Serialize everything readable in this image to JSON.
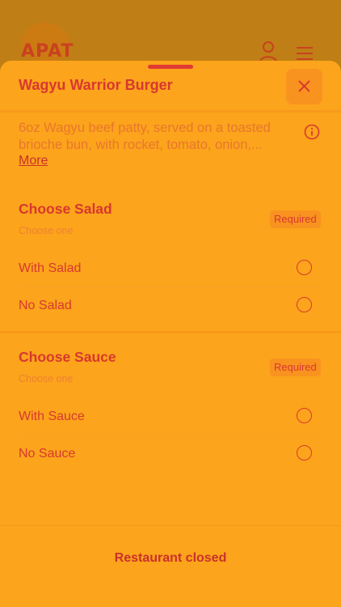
{
  "app": {
    "logo_text": "APAT",
    "profile_icon": "person-icon",
    "menu_icon": "hamburger-menu-icon"
  },
  "sheet": {
    "title": "Wagyu Warrior Burger",
    "close_icon": "close-icon",
    "description_line1": "6oz Wagyu beef patty, served on a toasted",
    "description_line2": "brioche bun, with rocket, tomato, onion,...",
    "more_label": "More",
    "info_icon": "info-icon"
  },
  "sections": [
    {
      "title": "Choose Salad",
      "subtitle": "Choose one",
      "badge": "Required",
      "options": [
        {
          "label": "With Salad",
          "selected": false
        },
        {
          "label": "No Salad",
          "selected": false
        }
      ]
    },
    {
      "title": "Choose Sauce",
      "subtitle": "Choose one",
      "badge": "Required",
      "options": [
        {
          "label": "With Sauce",
          "selected": false
        },
        {
          "label": "No Sauce",
          "selected": false
        }
      ]
    }
  ],
  "footer": {
    "status_label": "Restaurant closed"
  },
  "colors": {
    "accent": "#d8382f",
    "sheet_background": "#fca41b",
    "backdrop": "#bf7f16"
  }
}
